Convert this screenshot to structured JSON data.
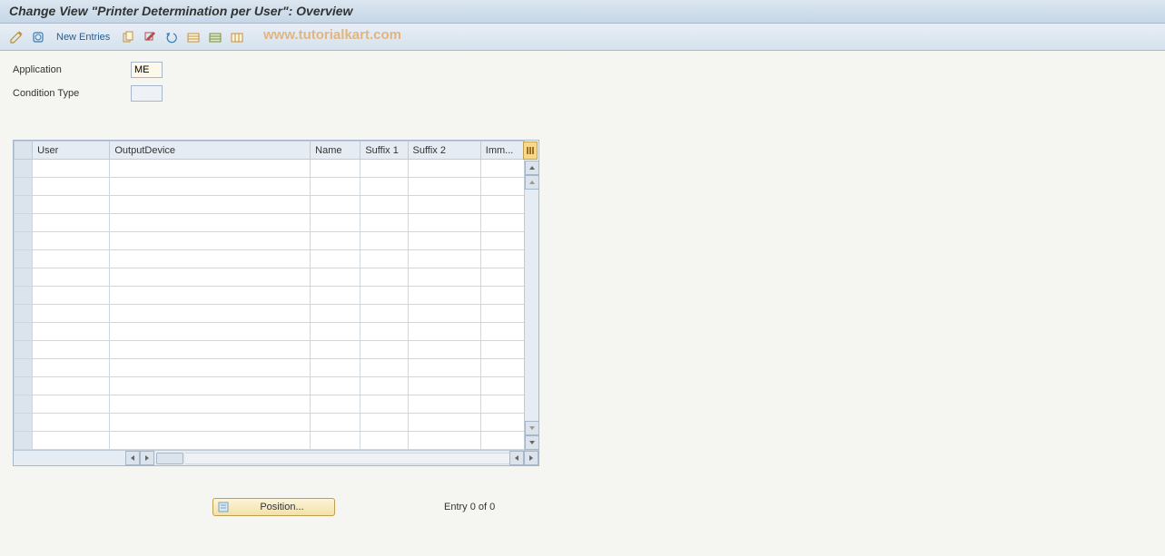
{
  "title": "Change View \"Printer Determination per User\": Overview",
  "toolbar": {
    "new_entries": "New Entries"
  },
  "watermark": "www.tutorialkart.com",
  "form": {
    "application_label": "Application",
    "application_value": "ME",
    "condition_type_label": "Condition Type",
    "condition_type_value": ""
  },
  "table": {
    "headers": {
      "user": "User",
      "output_device": "OutputDevice",
      "name": "Name",
      "suffix1": "Suffix 1",
      "suffix2": "Suffix 2",
      "imm": "Imm..."
    }
  },
  "footer": {
    "position_label": "Position...",
    "entry_text": "Entry 0 of 0"
  }
}
